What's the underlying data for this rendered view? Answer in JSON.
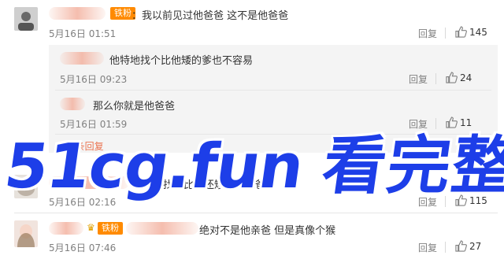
{
  "comment1": {
    "badge": "铁粉",
    "text": "：我以前见过他爸爸  这不是他爸爸",
    "date": "5月16日 01:51",
    "reply_label": "回复",
    "likes": "145"
  },
  "sub_replies": [
    {
      "text": "他特地找个比他矮的爹也不容易",
      "date": "5月16日 09:23",
      "reply_label": "回复",
      "likes": "24"
    },
    {
      "text": "那么你就是他爸爸",
      "date": "5月16日 01:59",
      "reply_label": "回复",
      "likes": "11"
    }
  ],
  "more_replies": "共4条回复",
  "comment2": {
    "text": "：故意找个比他还矮的当爸爸吗",
    "date": "5月16日 02:16",
    "reply_label": "回复",
    "likes": "115"
  },
  "comment3": {
    "badge": "铁粉",
    "text": "绝对不是他亲爸 但是真像个猴",
    "date": "5月16日 07:46",
    "reply_label": "回复",
    "likes": "27"
  },
  "watermark": {
    "latin": "51cg.fun",
    "cn": "看完整版"
  },
  "colors": {
    "accent": "#eb7350",
    "badge": "#ff8a00",
    "watermark": "#1d3ee8"
  }
}
